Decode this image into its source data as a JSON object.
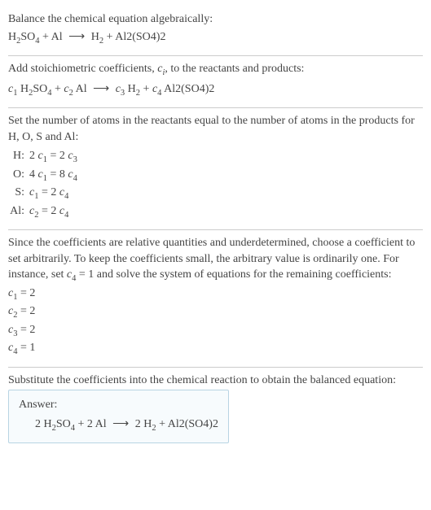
{
  "section1": {
    "line1_a": "Balance the chemical equation algebraically:",
    "eq_h2so4": "H",
    "eq_2": "2",
    "eq_so4": "SO",
    "eq_4": "4",
    "eq_plus1": " + Al ",
    "eq_arrow": "⟶",
    "eq_h2": " H",
    "eq_plus2": " + Al2(SO4)2"
  },
  "section2": {
    "line1": "Add stoichiometric coefficients, ",
    "ci": "c",
    "ci_i": "i",
    "line1b": ", to the reactants and products:",
    "c1": "c",
    "s1": "1",
    "h2so4": " H",
    "two": "2",
    "so": "SO",
    "four": "4",
    "plus": " + ",
    "c2": "c",
    "s2": "2",
    "al": " Al ",
    "arrow": "⟶",
    "sp": " ",
    "c3": "c",
    "s3": "3",
    "h2": " H",
    "c4": "c",
    "s4": "4",
    "al2so42": " Al2(SO4)2"
  },
  "section3": {
    "line1": "Set the number of atoms in the reactants equal to the number of atoms in the products for H, O, S and Al:",
    "rows": [
      {
        "label": "H:",
        "eq_a": "2 ",
        "c": "c",
        "i1": "1",
        "mid": " = 2 ",
        "c2": "c",
        "i2": "3"
      },
      {
        "label": "O:",
        "eq_a": "4 ",
        "c": "c",
        "i1": "1",
        "mid": " = 8 ",
        "c2": "c",
        "i2": "4"
      },
      {
        "label": "S:",
        "eq_a": "",
        "c": "c",
        "i1": "1",
        "mid": " = 2 ",
        "c2": "c",
        "i2": "4"
      },
      {
        "label": "Al:",
        "eq_a": "",
        "c": "c",
        "i1": "2",
        "mid": " = 2 ",
        "c2": "c",
        "i2": "4"
      }
    ]
  },
  "section4": {
    "line1": "Since the coefficients are relative quantities and underdetermined, choose a coefficient to set arbitrarily. To keep the coefficients small, the arbitrary value is ordinarily one. For instance, set ",
    "c4": "c",
    "s4": "4",
    "eq1": " = 1 and solve the system of equations for the remaining coefficients:",
    "coefs": [
      {
        "c": "c",
        "i": "1",
        "v": " = 2"
      },
      {
        "c": "c",
        "i": "2",
        "v": " = 2"
      },
      {
        "c": "c",
        "i": "3",
        "v": " = 2"
      },
      {
        "c": "c",
        "i": "4",
        "v": " = 1"
      }
    ]
  },
  "section5": {
    "line1": "Substitute the coefficients into the chemical reaction to obtain the balanced equation:",
    "answer_label": "Answer:",
    "ans_a": "2 H",
    "two": "2",
    "so": "SO",
    "four": "4",
    "plus": " + 2 Al ",
    "arrow": "⟶",
    "rhs_a": " 2 H",
    "rhs_b": " + Al2(SO4)2"
  }
}
